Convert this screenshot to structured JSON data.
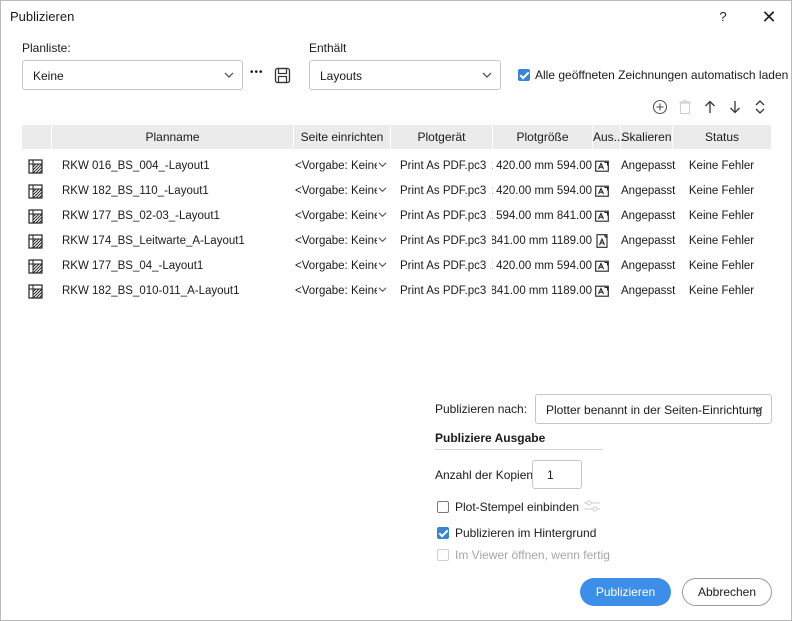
{
  "window": {
    "title": "Publizieren",
    "help_label": "?",
    "close_label": "✕"
  },
  "top": {
    "planliste_label": "Planliste:",
    "planliste_value": "Keine",
    "more_label": "•••",
    "enthaelt_label": "Enthält",
    "enthaelt_value": "Layouts",
    "auto_load_label": "Alle geöffneten Zeichnungen automatisch laden",
    "auto_load_checked": true
  },
  "table": {
    "columns": [
      "Planname",
      "Seite einrichten",
      "Plotgerät",
      "Plotgröße",
      "Aus...",
      "Skalieren",
      "Status"
    ],
    "rows": [
      {
        "name": "RKW 016_BS_004_-Layout1",
        "setup": "<Vorgabe: Keine>",
        "device": "Print As PDF.pc3",
        "size": "594.00 x 420.00 mm",
        "orientation": "landscape",
        "scale": "Angepasst",
        "status": "Keine Fehler"
      },
      {
        "name": "RKW 182_BS_110_-Layout1",
        "setup": "<Vorgabe: Keine>",
        "device": "Print As PDF.pc3",
        "size": "594.00 x 420.00 mm",
        "orientation": "landscape",
        "scale": "Angepasst",
        "status": "Keine Fehler"
      },
      {
        "name": "RKW 177_BS_02-03_-Layout1",
        "setup": "<Vorgabe: Keine>",
        "device": "Print As PDF.pc3",
        "size": "841.00 x 594.00 mm",
        "orientation": "landscape",
        "scale": "Angepasst",
        "status": "Keine Fehler"
      },
      {
        "name": "RKW 174_BS_Leitwarte_A-Layout1",
        "setup": "<Vorgabe: Keine>",
        "device": "Print As PDF.pc3",
        "size": "1189.00 x 841.00 mm",
        "orientation": "portrait",
        "scale": "Angepasst",
        "status": "Keine Fehler"
      },
      {
        "name": "RKW 177_BS_04_-Layout1",
        "setup": "<Vorgabe: Keine>",
        "device": "Print As PDF.pc3",
        "size": "594.00 x 420.00 mm",
        "orientation": "landscape",
        "scale": "Angepasst",
        "status": "Keine Fehler"
      },
      {
        "name": "RKW 182_BS_010-011_A-Layout1",
        "setup": "<Vorgabe: Keine>",
        "device": "Print As PDF.pc3",
        "size": "1189.00 x 841.00 mm",
        "orientation": "landscape",
        "scale": "Angepasst",
        "status": "Keine Fehler"
      }
    ]
  },
  "output": {
    "publish_to_label": "Publizieren nach:",
    "publish_to_value": "Plotter benannt in der Seiten-Einrichtung",
    "section_title": "Publiziere Ausgabe",
    "copies_label": "Anzahl der Kopien:",
    "copies_value": "1",
    "plot_stamp_label": "Plot-Stempel einbinden",
    "plot_stamp_checked": false,
    "background_label": "Publizieren im Hintergrund",
    "background_checked": true,
    "viewer_label": "Im Viewer öffnen, wenn fertig",
    "viewer_checked": false,
    "viewer_enabled": false
  },
  "buttons": {
    "publish_label": "Publizieren",
    "cancel_label": "Abbrechen"
  },
  "colors": {
    "accent": "#3d8ee8",
    "header_bg": "#ebebeb"
  }
}
